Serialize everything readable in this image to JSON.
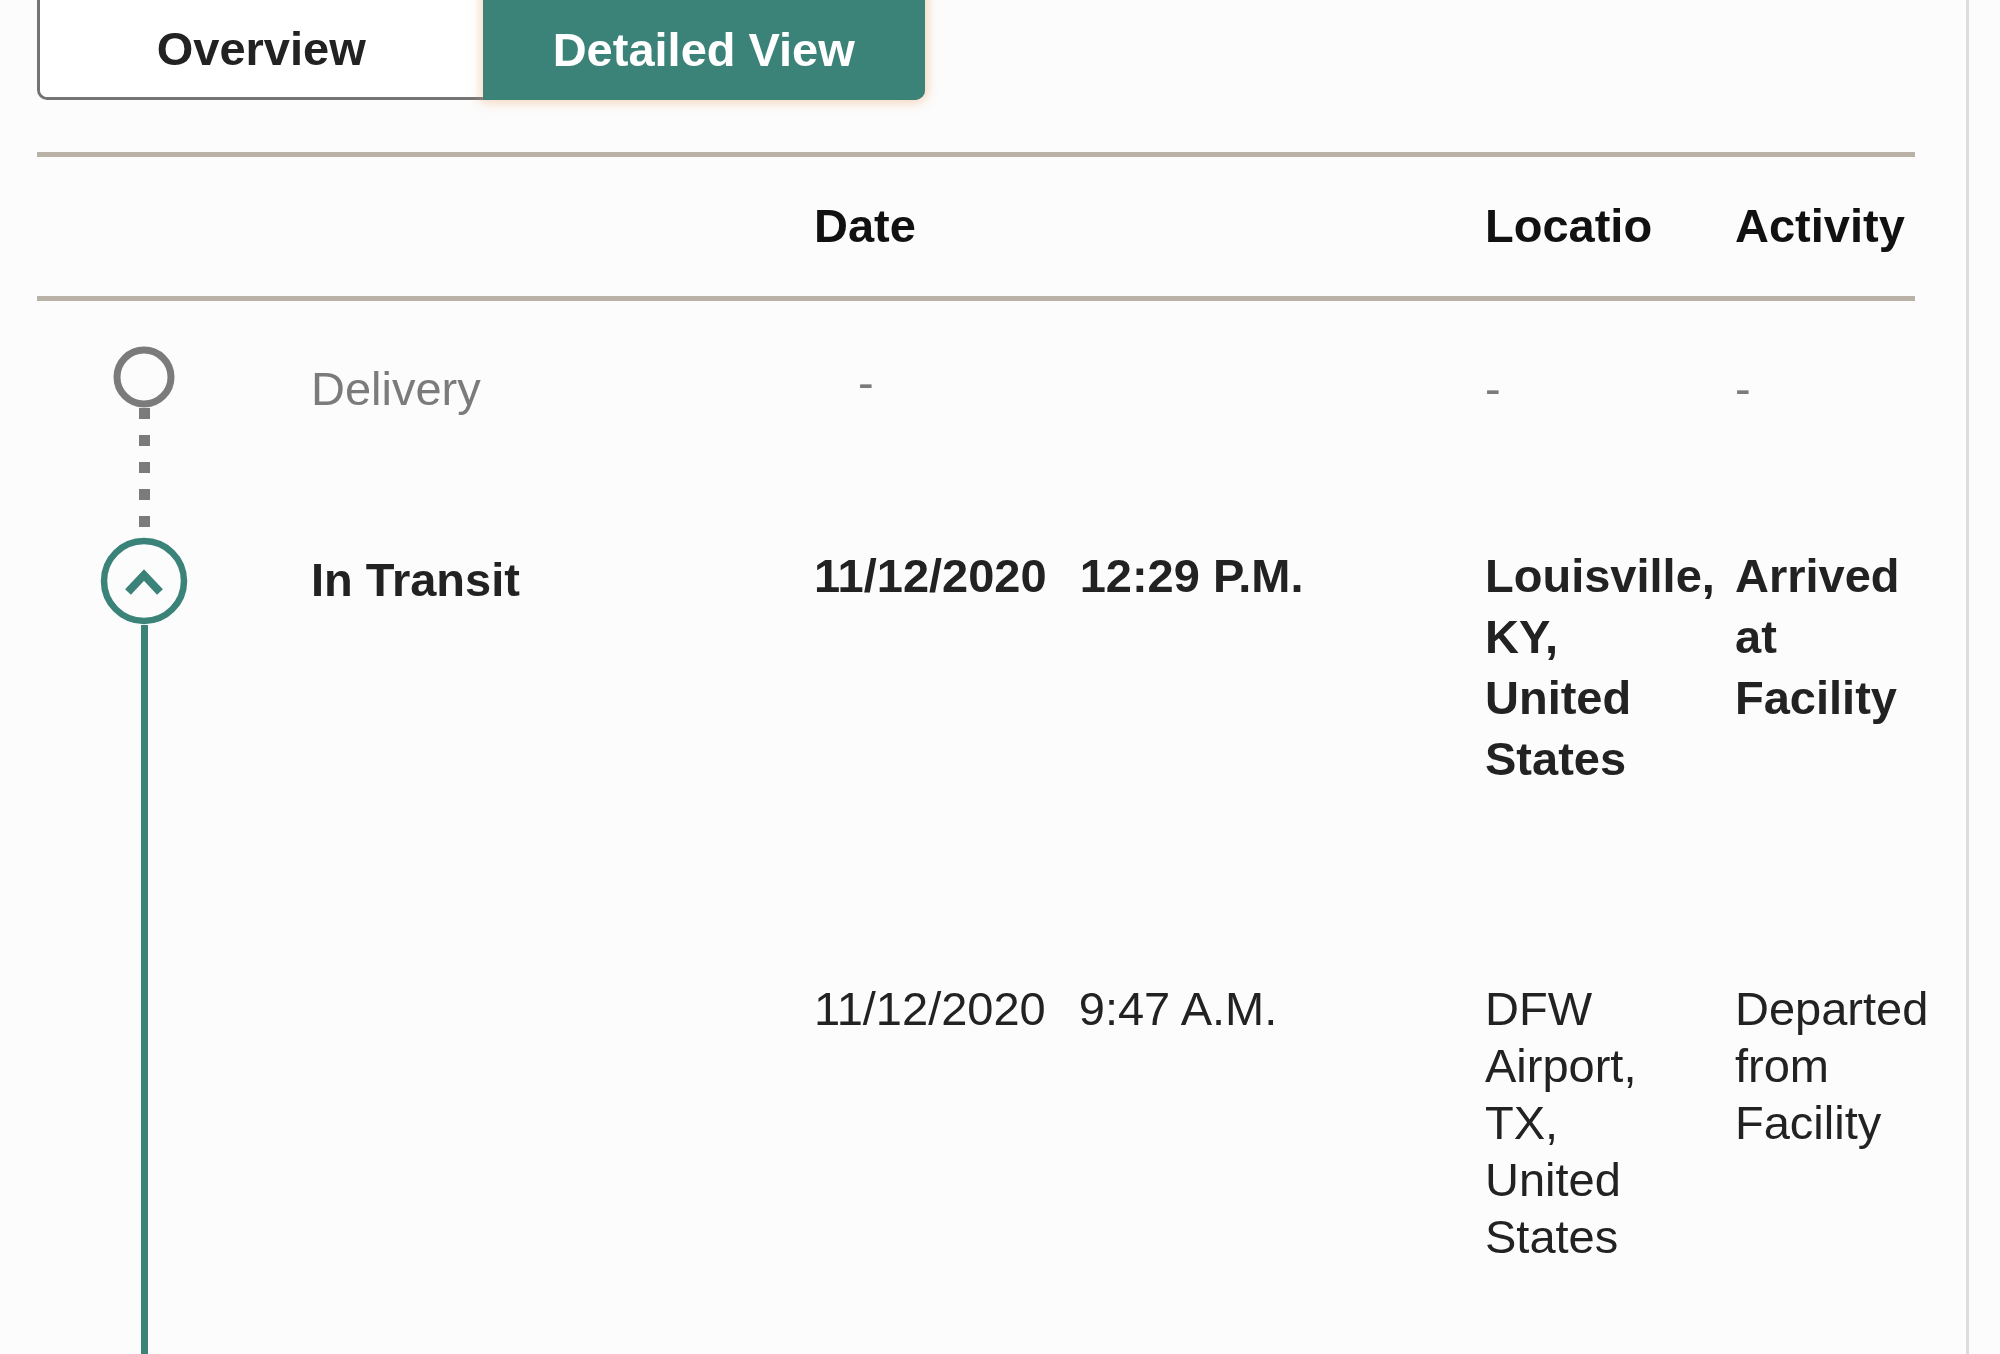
{
  "tabs": [
    {
      "label": "Overview",
      "selected": false
    },
    {
      "label": "Detailed View",
      "selected": true
    }
  ],
  "columns": [
    "Date",
    "Locatio",
    "Activity"
  ],
  "milestones": [
    {
      "status": "Delivery",
      "reached": false,
      "expanded": false,
      "entries": [
        {
          "date": "-",
          "location": "-",
          "activity": "-",
          "latest": false
        }
      ]
    },
    {
      "status": "In Transit",
      "reached": true,
      "expanded": true,
      "entries": [
        {
          "date": "11/12/2020",
          "time": "12:29 P.M.",
          "location": "Louisville, KY, United States",
          "activity": "Arrived at Facility",
          "latest": true
        },
        {
          "date": "11/12/2020",
          "time": "9:47 A.M.",
          "location": "DFW Airport, TX, United States",
          "activity": "Departed from Facility",
          "latest": false
        }
      ]
    }
  ]
}
